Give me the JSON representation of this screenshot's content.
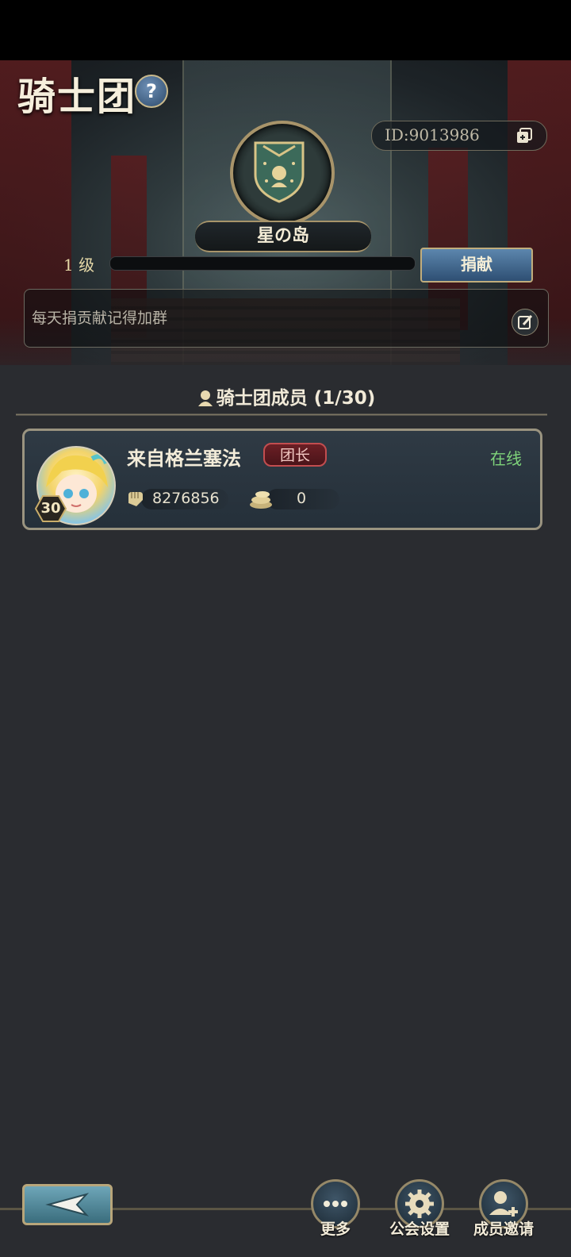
{
  "header": {
    "title": "骑士团",
    "guild_id": "ID:9013986",
    "guild_name": "星の岛",
    "level_text": "1  级",
    "xp_progress": 0.0,
    "donate_label": "捐献",
    "notice": "每天捐贡献记得加群"
  },
  "members": {
    "heading": "骑士团成员 (1/30)",
    "list": [
      {
        "name": "来自格兰塞法",
        "role": "团长",
        "status": "在线",
        "level": "30",
        "power": "8276856",
        "contribution": "0"
      }
    ]
  },
  "bottom": {
    "more_label": "更多",
    "settings_label": "公会设置",
    "invite_label": "成员邀请"
  },
  "colors": {
    "accent_gold": "#c1ad7c",
    "online_green": "#7fd37a",
    "role_red": "#6b1f25"
  }
}
